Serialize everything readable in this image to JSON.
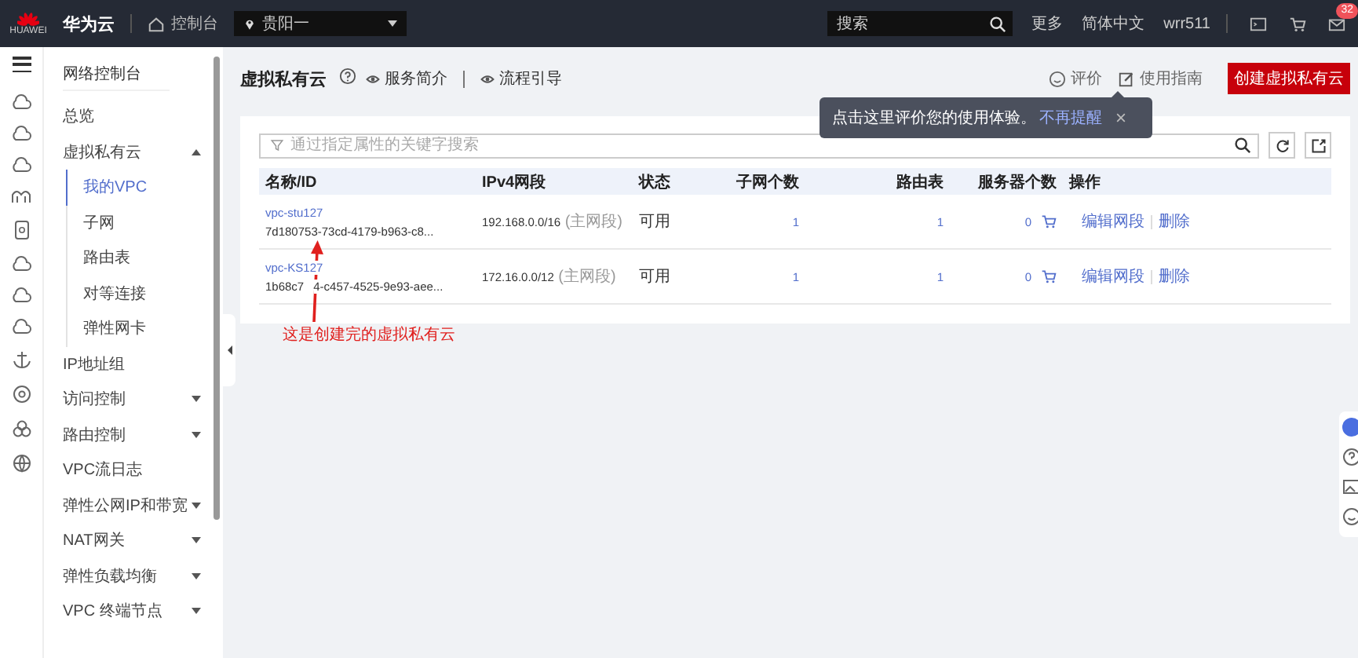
{
  "header": {
    "logo_text": "HUAWEI",
    "brand": "华为云",
    "console": "控制台",
    "region": "贵阳一",
    "search": {
      "placeholder": "搜索"
    },
    "links": [
      "更多",
      "简体中文",
      "wrr511"
    ],
    "mail_badge": "32"
  },
  "sidebar": {
    "title": "网络控制台",
    "items": [
      {
        "label": "总览",
        "selected": false
      },
      {
        "label": "虚拟私有云",
        "selected": false,
        "expanded": true,
        "children": [
          {
            "label": "我的VPC",
            "selected": true
          },
          {
            "label": "子网",
            "selected": false
          },
          {
            "label": "路由表",
            "selected": false
          },
          {
            "label": "对等连接",
            "selected": false
          },
          {
            "label": "弹性网卡",
            "selected": false
          }
        ]
      },
      {
        "label": "IP地址组",
        "selected": false
      },
      {
        "label": "访问控制",
        "selected": false,
        "expanded": false
      },
      {
        "label": "路由控制",
        "selected": false,
        "expanded": false
      },
      {
        "label": "VPC流日志",
        "selected": false
      },
      {
        "label": "弹性公网IP和带宽",
        "selected": false,
        "expanded": false
      },
      {
        "label": "NAT网关",
        "selected": false,
        "expanded": false
      },
      {
        "label": "弹性负载均衡",
        "selected": false,
        "expanded": false
      },
      {
        "label": "VPC 终端节点",
        "selected": false,
        "expanded": false
      }
    ]
  },
  "page": {
    "title": "虚拟私有云",
    "links": [
      "服务简介",
      "流程引导"
    ],
    "rate": "评价",
    "guide": "使用指南",
    "create_button": "创建虚拟私有云"
  },
  "tooltip": {
    "text": "点击这里评价您的使用体验。",
    "link": "不再提醒"
  },
  "table": {
    "search": {
      "placeholder": "通过指定属性的关键字搜索"
    },
    "columns": [
      "名称/ID",
      "IPv4网段",
      "状态",
      "子网个数",
      "路由表",
      "服务器个数",
      "操作"
    ],
    "rows": [
      {
        "name": "vpc-stu127",
        "id_parts": [
          "7d180753-73cd-4179-b963-c8..."
        ],
        "cidr": "192.168.0.0/16",
        "cidr_note": "(主网段)",
        "status": "可用",
        "subnets": "1",
        "route_tables": "1",
        "servers": "0",
        "actions": [
          "编辑网段",
          "删除"
        ]
      },
      {
        "name": "vpc-KS127",
        "id_parts": [
          "1b68c7",
          "4-c457-4525-9e93-aee..."
        ],
        "cidr": "172.16.0.0/12",
        "cidr_note": "(主网段)",
        "status": "可用",
        "subnets": "1",
        "route_tables": "1",
        "servers": "0",
        "actions": [
          "编辑网段",
          "删除"
        ]
      }
    ]
  },
  "annotation": {
    "text": "这是创建完的虚拟私有云"
  }
}
